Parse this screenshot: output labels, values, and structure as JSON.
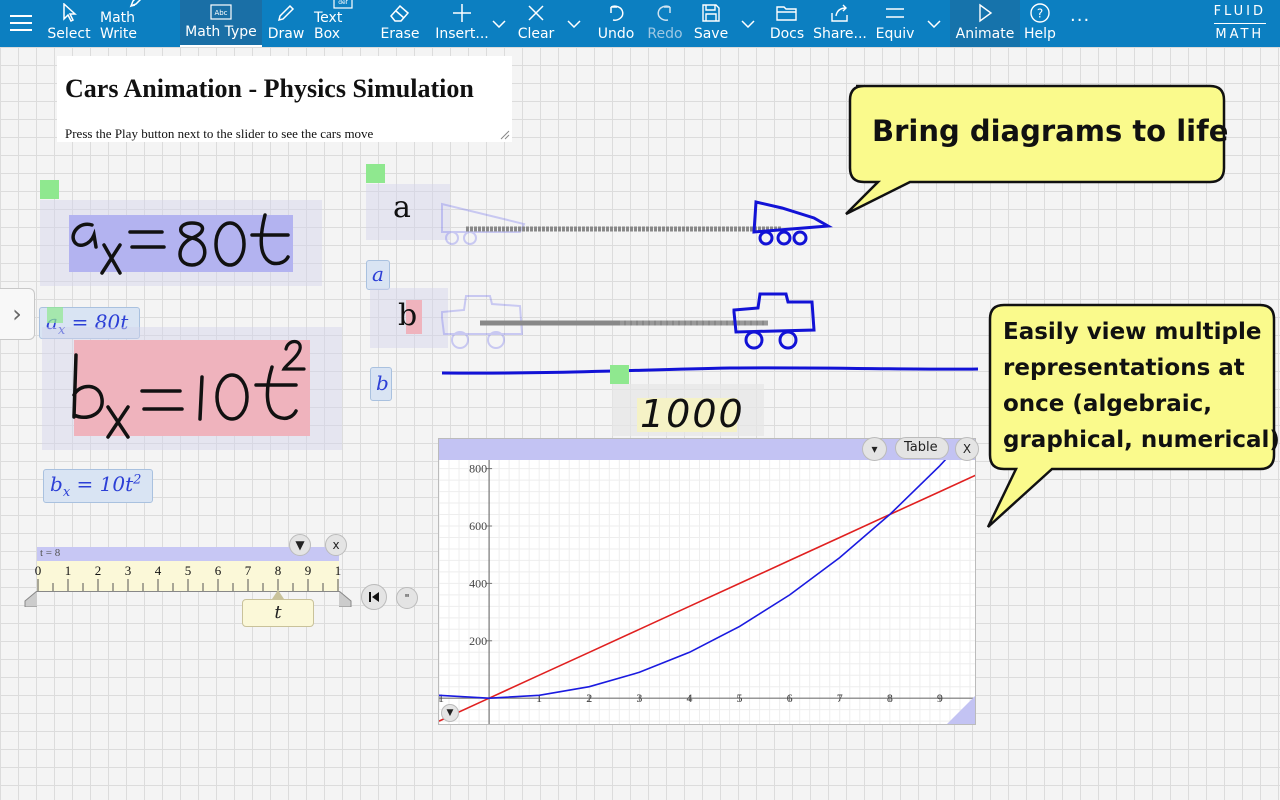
{
  "toolbar": {
    "items": [
      {
        "label": "Select",
        "icon": "cursor-icon"
      },
      {
        "label": "Math Write",
        "icon": "pen-icon"
      },
      {
        "label": "Math Type",
        "icon": "abc-icon",
        "active": true
      },
      {
        "label": "Draw",
        "icon": "pencil-icon"
      },
      {
        "label": "Text Box",
        "icon": "textbox-icon"
      },
      {
        "label": "Erase",
        "icon": "eraser-icon"
      },
      {
        "label": "Insert...",
        "icon": "plus-icon"
      },
      {
        "label": "Clear",
        "icon": "x-icon"
      },
      {
        "label": "Undo",
        "icon": "undo-icon"
      },
      {
        "label": "Redo",
        "icon": "redo-icon",
        "disabled": true
      },
      {
        "label": "Save",
        "icon": "save-icon"
      },
      {
        "label": "Docs",
        "icon": "folder-icon"
      },
      {
        "label": "Share...",
        "icon": "share-icon"
      },
      {
        "label": "Equiv",
        "icon": "equiv-icon"
      },
      {
        "label": "Animate",
        "icon": "play-icon"
      },
      {
        "label": "Help",
        "icon": "help-icon"
      }
    ],
    "brand_top": "FLUID",
    "brand_bottom": "MATH",
    "more": "···",
    "color": "#0c7fc1"
  },
  "document": {
    "title": "Cars Animation - Physics Simulation",
    "subtitle": "Press the Play button next to the slider to see the cars move"
  },
  "equations": {
    "a_handwritten": "ax = 80t",
    "a_typed_lhs": "a",
    "a_typed_sub": "x",
    "a_typed_rhs": "= 80t",
    "b_handwritten": "bx = 10t²",
    "b_typed_lhs": "b",
    "b_typed_sub": "x",
    "b_typed_rhs": "= 10t",
    "b_typed_exp": "2",
    "a_var": "a",
    "b_var": "b",
    "a_label": "a",
    "b_label": "b",
    "number": "1000"
  },
  "slider": {
    "header": "t = 8",
    "ticks": [
      "0",
      "1",
      "2",
      "3",
      "4",
      "5",
      "6",
      "7",
      "8",
      "9",
      "1"
    ],
    "variable": "t",
    "value": 8,
    "min": 0,
    "max": 10
  },
  "graph": {
    "dropdown": "▾",
    "table_label": "Table",
    "close_label": "X"
  },
  "callouts": {
    "one": "Bring diagrams to life",
    "two": [
      "Easily view multiple",
      "representations at",
      "once (algebraic,",
      "graphical, numerical)"
    ]
  },
  "chart_data": {
    "type": "line",
    "x": [
      -1,
      0,
      1,
      2,
      3,
      4,
      5,
      6,
      7,
      8,
      9,
      10
    ],
    "series": [
      {
        "values": [
          -80,
          0,
          80,
          160,
          240,
          320,
          400,
          480,
          560,
          640,
          720,
          800
        ],
        "color": "#e02020"
      },
      {
        "values": [
          10,
          0,
          10,
          40,
          90,
          160,
          250,
          360,
          490,
          640,
          810,
          1000
        ],
        "color": "#1a1ae0"
      }
    ],
    "xticks": [
      "1",
      "1",
      "2",
      "3",
      "4",
      "5",
      "6",
      "7",
      "8",
      "9"
    ],
    "yticks": [
      "200",
      "400",
      "600",
      "800"
    ],
    "xlim": [
      -1,
      9.7
    ],
    "ylim": [
      -90,
      830
    ]
  }
}
